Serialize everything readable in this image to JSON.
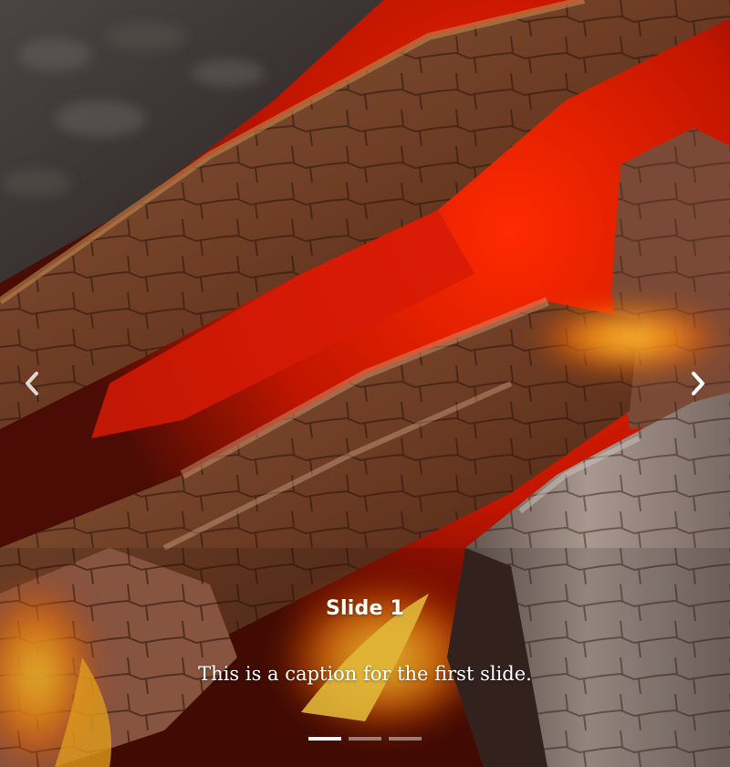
{
  "carousel": {
    "slides": [
      {
        "title": "Slide 1",
        "caption": "This is a caption for the first slide."
      }
    ],
    "active_index": 0,
    "indicator_count": 3,
    "controls": {
      "prev_icon": "chevron-left-icon",
      "next_icon": "chevron-right-icon"
    }
  },
  "colors": {
    "caption_text": "#ffffff",
    "ember_red": "#e8200a",
    "flame_orange": "#f7931e",
    "ash_gray": "#8a7a70"
  }
}
